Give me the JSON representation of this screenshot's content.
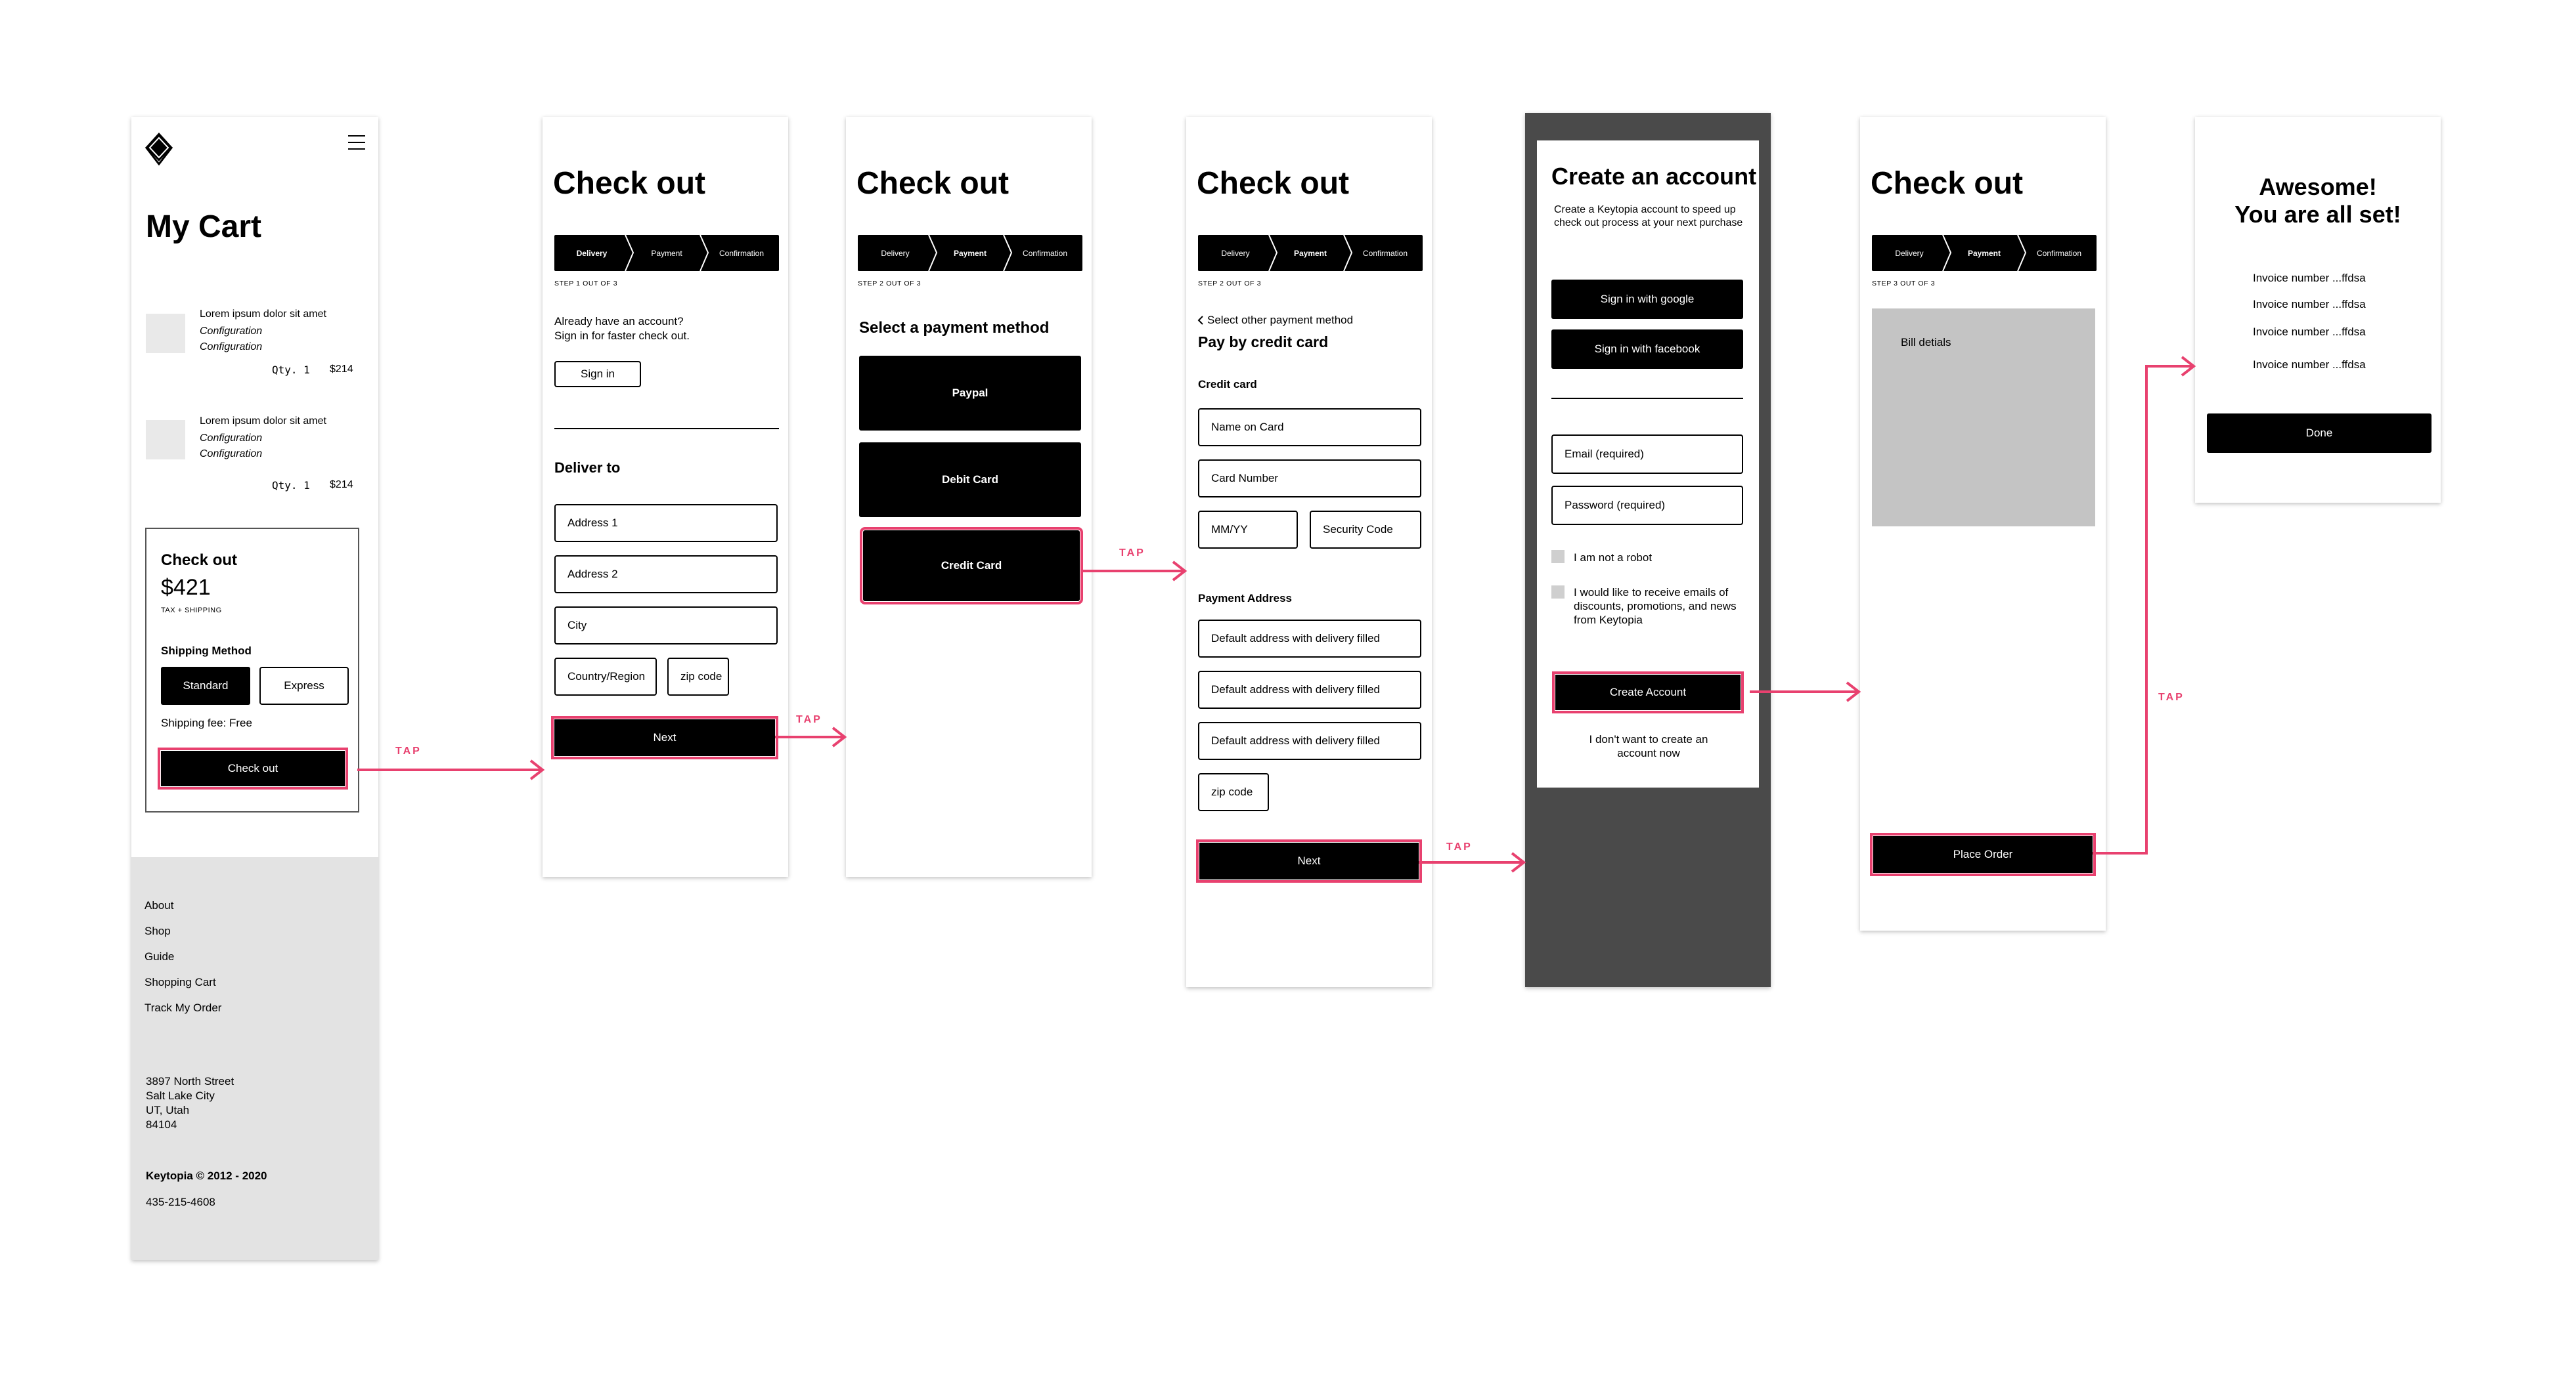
{
  "cart": {
    "title": "My Cart",
    "items": [
      {
        "name": "Lorem ipsum dolor sit amet",
        "config1": "Configuration",
        "config2": "Configuration",
        "qty": "Qty. 1",
        "price": "$214"
      },
      {
        "name": "Lorem ipsum dolor sit amet",
        "config1": "Configuration",
        "config2": "Configuration",
        "qty": "Qty. 1",
        "price": "$214"
      }
    ],
    "checkout_title": "Check out",
    "total": "$421",
    "tax_note": "TAX + SHIPPING",
    "shipping_method_label": "Shipping Method",
    "standard_label": "Standard",
    "express_label": "Express",
    "shipping_fee": "Shipping fee: Free",
    "checkout_button": "Check out",
    "footer_links": [
      "About",
      "Shop",
      "Guide",
      "Shopping Cart",
      "Track My Order"
    ],
    "address_lines": [
      "3897  North Street",
      "Salt Lake City",
      "UT, Utah",
      "84104"
    ],
    "copyright": "Keytopia © 2012 - 2020",
    "phone": "435-215-4608"
  },
  "steps": {
    "delivery": "Delivery",
    "payment": "Payment",
    "confirmation": "Confirmation"
  },
  "delivery": {
    "title": "Check out",
    "step_note": "STEP 1 OUT OF 3",
    "account_prompt_1": "Already have an account?",
    "account_prompt_2": "Sign in for faster check out.",
    "sign_in": "Sign in",
    "deliver_to": "Deliver to",
    "address1": "Address 1",
    "address2": "Address 2",
    "city": "City",
    "country": "Country/Region",
    "zip": "zip code",
    "next": "Next"
  },
  "payment_method": {
    "title": "Check out",
    "step_note": "STEP 2 OUT OF 3",
    "heading": "Select a payment method",
    "options": [
      "Paypal",
      "Debit Card",
      "Credit Card"
    ]
  },
  "credit_card": {
    "title": "Check out",
    "step_note": "STEP 2 OUT OF 3",
    "back_link": "Select other payment method",
    "heading": "Pay by credit card",
    "credit_card_label": "Credit card",
    "name_on_card": "Name on Card",
    "card_number": "Card Number",
    "mm_yy": "MM/YY",
    "security_code": "Security Code",
    "payment_address_label": "Payment Address",
    "default_address": "Default address with delivery filled",
    "zip": "zip code",
    "next": "Next"
  },
  "create_account": {
    "title": "Create an account",
    "description": "Create a Keytopia account to speed up check out process at your next purchase",
    "google": "Sign in with google",
    "facebook": "Sign in with facebook",
    "email": "Email (required)",
    "password": "Password (required)",
    "robot": "I am not a robot",
    "emails_optin": "I would like to receive emails of discounts, promotions, and news from Keytopia",
    "create_button": "Create Account",
    "skip": "I don't want to create an account now"
  },
  "review": {
    "title": "Check out",
    "step_note": "STEP 3 OUT OF 3",
    "bill_details": "Bill detials",
    "place_order": "Place Order"
  },
  "done": {
    "title_line1": "Awesome!",
    "title_line2": "You are all set!",
    "invoices": [
      "Invoice  number ...ffdsa",
      "Invoice  number ...ffdsa",
      "Invoice  number ...ffdsa",
      "Invoice  number ...ffdsa"
    ],
    "done_button": "Done"
  },
  "tap_label": "TAP",
  "colors": {
    "accent": "#e8416f",
    "footer_bg": "#e3e3e3",
    "dark_frame": "#4a4a4a",
    "bill_bg": "#c4c4c4"
  }
}
